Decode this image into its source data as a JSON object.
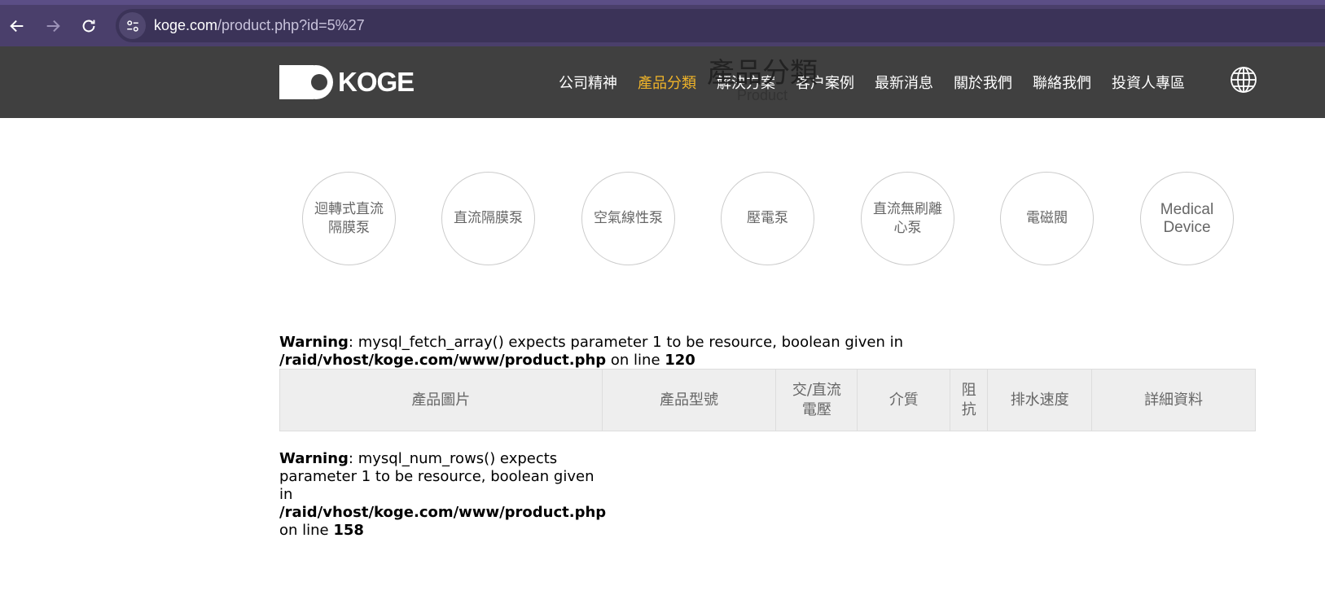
{
  "browser": {
    "url_host": "koge.com",
    "url_path": "/product.php?id=5%27"
  },
  "header": {
    "logo_text": "KOGE",
    "nav": [
      {
        "label": "公司精神",
        "active": false
      },
      {
        "label": "產品分類",
        "active": true
      },
      {
        "label": "解決方案",
        "active": false
      },
      {
        "label": "客户案例",
        "active": false
      },
      {
        "label": "最新消息",
        "active": false
      },
      {
        "label": "關於我們",
        "active": false
      },
      {
        "label": "聯絡我們",
        "active": false
      },
      {
        "label": "投資人專區",
        "active": false
      }
    ],
    "accent_color": "#f0b429"
  },
  "page": {
    "heading": "產品分類",
    "subheading": "Product"
  },
  "categories": [
    {
      "label": "迴轉式直流隔膜泵"
    },
    {
      "label": "直流隔膜泵"
    },
    {
      "label": "空氣線性泵"
    },
    {
      "label": "壓電泵"
    },
    {
      "label": "直流無刷離心泵"
    },
    {
      "label": "電磁閥"
    },
    {
      "label": "Medical Device"
    }
  ],
  "warnings": [
    {
      "label": "Warning",
      "message": ": mysql_fetch_array() expects parameter 1 to be resource, boolean given in",
      "path": "/raid/vhost/koge.com/www/product.php",
      "line_prefix": " on line ",
      "line": "120"
    },
    {
      "label": "Warning",
      "message": ": mysql_num_rows() expects parameter 1 to be resource, boolean given in",
      "path": "/raid/vhost/koge.com/www/product.php",
      "line_prefix": "on line ",
      "line": "158"
    }
  ],
  "table": {
    "columns": [
      "產品圖片",
      "產品型號",
      "交/直流電壓",
      "介質",
      "阻抗",
      "排水速度",
      "詳細資料"
    ]
  }
}
